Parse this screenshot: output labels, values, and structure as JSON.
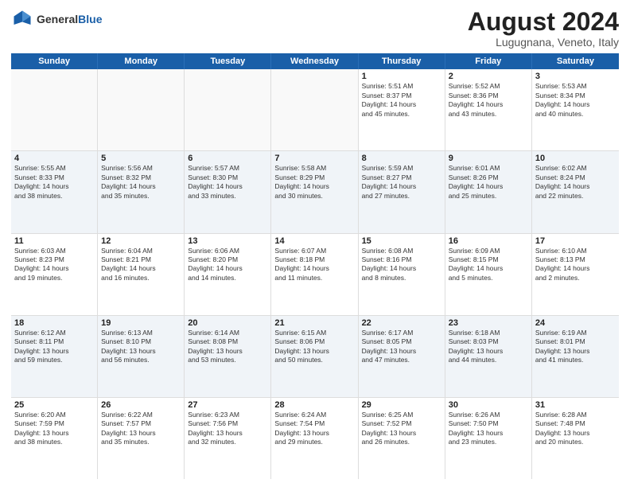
{
  "header": {
    "logo_general": "General",
    "logo_blue": "Blue",
    "month_year": "August 2024",
    "location": "Lugugnana, Veneto, Italy"
  },
  "weekdays": [
    "Sunday",
    "Monday",
    "Tuesday",
    "Wednesday",
    "Thursday",
    "Friday",
    "Saturday"
  ],
  "rows": [
    [
      {
        "day": "",
        "text": "",
        "empty": true
      },
      {
        "day": "",
        "text": "",
        "empty": true
      },
      {
        "day": "",
        "text": "",
        "empty": true
      },
      {
        "day": "",
        "text": "",
        "empty": true
      },
      {
        "day": "1",
        "text": "Sunrise: 5:51 AM\nSunset: 8:37 PM\nDaylight: 14 hours\nand 45 minutes.",
        "empty": false
      },
      {
        "day": "2",
        "text": "Sunrise: 5:52 AM\nSunset: 8:36 PM\nDaylight: 14 hours\nand 43 minutes.",
        "empty": false
      },
      {
        "day": "3",
        "text": "Sunrise: 5:53 AM\nSunset: 8:34 PM\nDaylight: 14 hours\nand 40 minutes.",
        "empty": false
      }
    ],
    [
      {
        "day": "4",
        "text": "Sunrise: 5:55 AM\nSunset: 8:33 PM\nDaylight: 14 hours\nand 38 minutes.",
        "empty": false
      },
      {
        "day": "5",
        "text": "Sunrise: 5:56 AM\nSunset: 8:32 PM\nDaylight: 14 hours\nand 35 minutes.",
        "empty": false
      },
      {
        "day": "6",
        "text": "Sunrise: 5:57 AM\nSunset: 8:30 PM\nDaylight: 14 hours\nand 33 minutes.",
        "empty": false
      },
      {
        "day": "7",
        "text": "Sunrise: 5:58 AM\nSunset: 8:29 PM\nDaylight: 14 hours\nand 30 minutes.",
        "empty": false
      },
      {
        "day": "8",
        "text": "Sunrise: 5:59 AM\nSunset: 8:27 PM\nDaylight: 14 hours\nand 27 minutes.",
        "empty": false
      },
      {
        "day": "9",
        "text": "Sunrise: 6:01 AM\nSunset: 8:26 PM\nDaylight: 14 hours\nand 25 minutes.",
        "empty": false
      },
      {
        "day": "10",
        "text": "Sunrise: 6:02 AM\nSunset: 8:24 PM\nDaylight: 14 hours\nand 22 minutes.",
        "empty": false
      }
    ],
    [
      {
        "day": "11",
        "text": "Sunrise: 6:03 AM\nSunset: 8:23 PM\nDaylight: 14 hours\nand 19 minutes.",
        "empty": false
      },
      {
        "day": "12",
        "text": "Sunrise: 6:04 AM\nSunset: 8:21 PM\nDaylight: 14 hours\nand 16 minutes.",
        "empty": false
      },
      {
        "day": "13",
        "text": "Sunrise: 6:06 AM\nSunset: 8:20 PM\nDaylight: 14 hours\nand 14 minutes.",
        "empty": false
      },
      {
        "day": "14",
        "text": "Sunrise: 6:07 AM\nSunset: 8:18 PM\nDaylight: 14 hours\nand 11 minutes.",
        "empty": false
      },
      {
        "day": "15",
        "text": "Sunrise: 6:08 AM\nSunset: 8:16 PM\nDaylight: 14 hours\nand 8 minutes.",
        "empty": false
      },
      {
        "day": "16",
        "text": "Sunrise: 6:09 AM\nSunset: 8:15 PM\nDaylight: 14 hours\nand 5 minutes.",
        "empty": false
      },
      {
        "day": "17",
        "text": "Sunrise: 6:10 AM\nSunset: 8:13 PM\nDaylight: 14 hours\nand 2 minutes.",
        "empty": false
      }
    ],
    [
      {
        "day": "18",
        "text": "Sunrise: 6:12 AM\nSunset: 8:11 PM\nDaylight: 13 hours\nand 59 minutes.",
        "empty": false
      },
      {
        "day": "19",
        "text": "Sunrise: 6:13 AM\nSunset: 8:10 PM\nDaylight: 13 hours\nand 56 minutes.",
        "empty": false
      },
      {
        "day": "20",
        "text": "Sunrise: 6:14 AM\nSunset: 8:08 PM\nDaylight: 13 hours\nand 53 minutes.",
        "empty": false
      },
      {
        "day": "21",
        "text": "Sunrise: 6:15 AM\nSunset: 8:06 PM\nDaylight: 13 hours\nand 50 minutes.",
        "empty": false
      },
      {
        "day": "22",
        "text": "Sunrise: 6:17 AM\nSunset: 8:05 PM\nDaylight: 13 hours\nand 47 minutes.",
        "empty": false
      },
      {
        "day": "23",
        "text": "Sunrise: 6:18 AM\nSunset: 8:03 PM\nDaylight: 13 hours\nand 44 minutes.",
        "empty": false
      },
      {
        "day": "24",
        "text": "Sunrise: 6:19 AM\nSunset: 8:01 PM\nDaylight: 13 hours\nand 41 minutes.",
        "empty": false
      }
    ],
    [
      {
        "day": "25",
        "text": "Sunrise: 6:20 AM\nSunset: 7:59 PM\nDaylight: 13 hours\nand 38 minutes.",
        "empty": false
      },
      {
        "day": "26",
        "text": "Sunrise: 6:22 AM\nSunset: 7:57 PM\nDaylight: 13 hours\nand 35 minutes.",
        "empty": false
      },
      {
        "day": "27",
        "text": "Sunrise: 6:23 AM\nSunset: 7:56 PM\nDaylight: 13 hours\nand 32 minutes.",
        "empty": false
      },
      {
        "day": "28",
        "text": "Sunrise: 6:24 AM\nSunset: 7:54 PM\nDaylight: 13 hours\nand 29 minutes.",
        "empty": false
      },
      {
        "day": "29",
        "text": "Sunrise: 6:25 AM\nSunset: 7:52 PM\nDaylight: 13 hours\nand 26 minutes.",
        "empty": false
      },
      {
        "day": "30",
        "text": "Sunrise: 6:26 AM\nSunset: 7:50 PM\nDaylight: 13 hours\nand 23 minutes.",
        "empty": false
      },
      {
        "day": "31",
        "text": "Sunrise: 6:28 AM\nSunset: 7:48 PM\nDaylight: 13 hours\nand 20 minutes.",
        "empty": false
      }
    ]
  ]
}
